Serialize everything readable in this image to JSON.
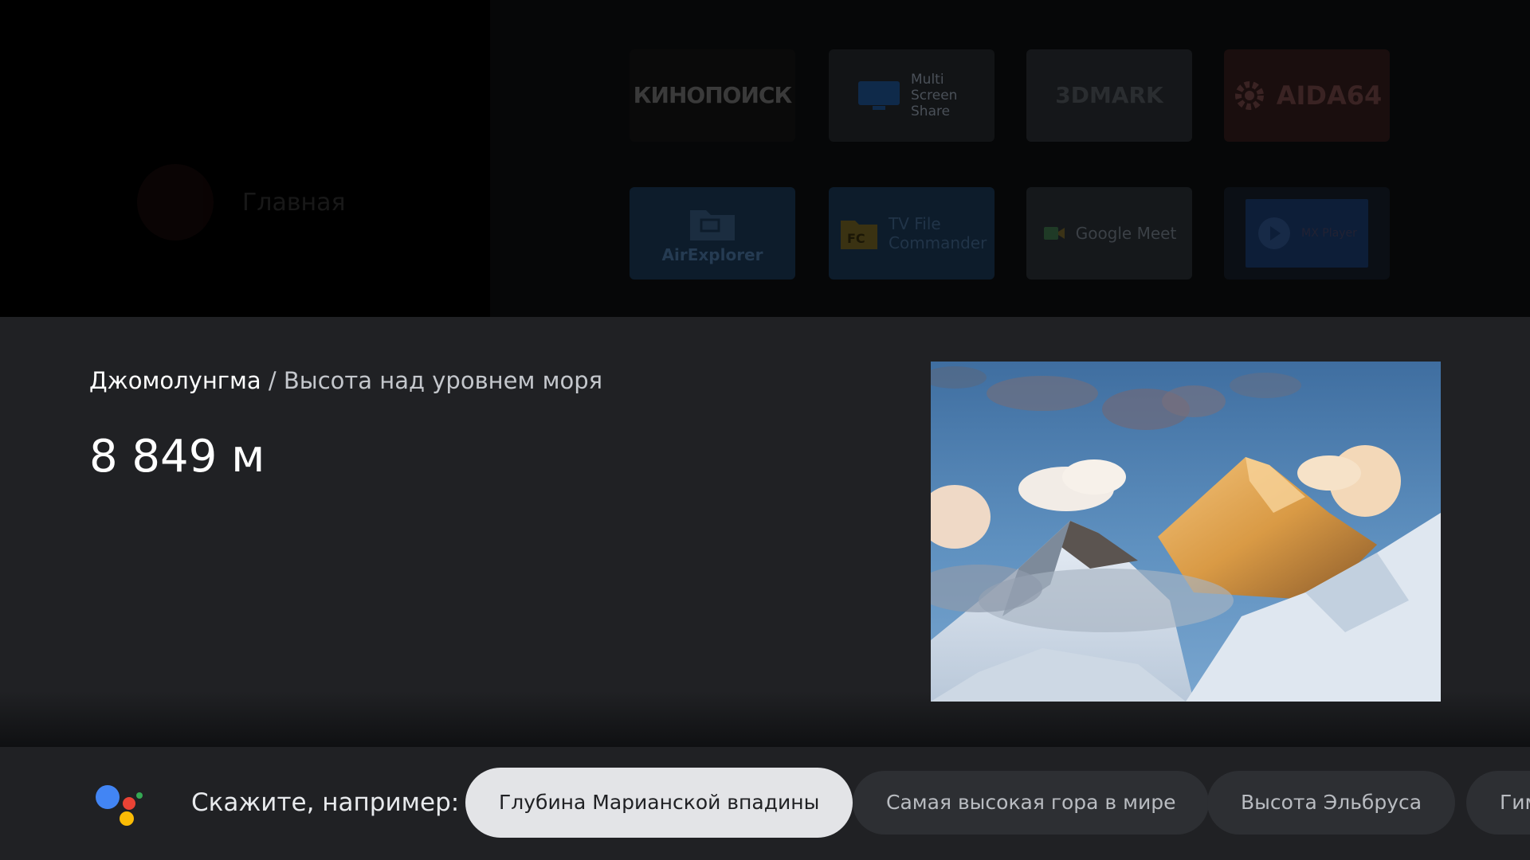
{
  "home": {
    "profile_name": "Главная",
    "tiles": [
      {
        "label": "КИНОПОИСК",
        "icon": "kinopoisk-logo"
      },
      {
        "label": "Multi Screen Share",
        "icon": "monitor-icon"
      },
      {
        "label": "3DMARK",
        "icon": "3dmark-logo"
      },
      {
        "label": "AIDA64",
        "icon": "gear-icon"
      },
      {
        "label": "AirExplorer",
        "icon": "folder-monitor-icon"
      },
      {
        "label": "TV File Commander",
        "icon": "folder-fc-icon"
      },
      {
        "label": "Google Meet",
        "icon": "meet-icon"
      },
      {
        "label": "MX Player",
        "icon": "play-icon"
      }
    ]
  },
  "answer": {
    "entity": "Джомолунгма",
    "separator": "/",
    "attribute": "Высота над уровнем моря",
    "value": "8 849 м",
    "image": "mountain-photo"
  },
  "suggestions": {
    "prompt": "Скажите, например:",
    "chips": [
      "Глубина Марианской впадины",
      "Самая высокая гора в мире",
      "Высота Эльбруса",
      "Гим"
    ],
    "active_index": 0
  },
  "colors": {
    "card_bg": "#202124",
    "chip_bg": "#2d2f33",
    "chip_active_bg": "#e3e4e7",
    "assistant_blue": "#4285f4",
    "assistant_red": "#ea4335",
    "assistant_yellow": "#fbbc05",
    "assistant_green": "#34a853"
  }
}
